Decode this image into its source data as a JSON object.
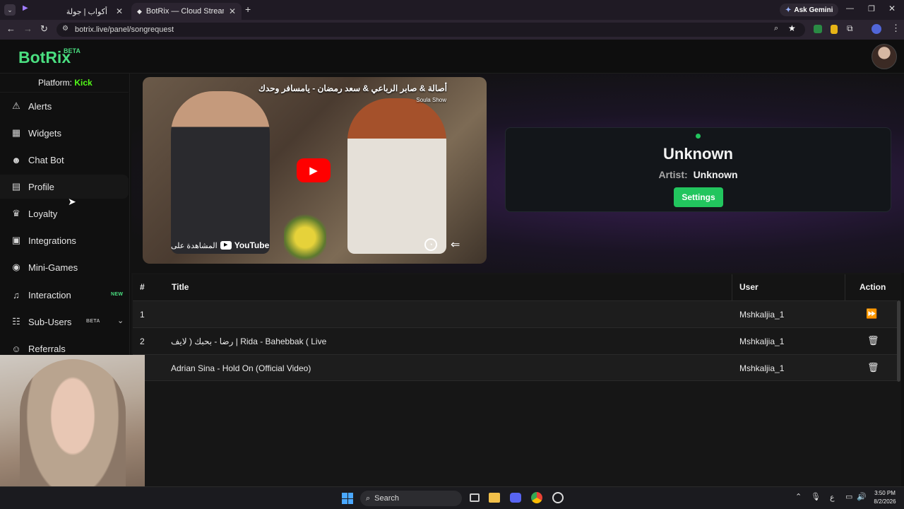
{
  "browser": {
    "tabs": [
      {
        "title": "أكواب | جولة",
        "active": false
      },
      {
        "title": "BotRix — Cloud Streaming Bot",
        "active": true
      }
    ],
    "ask_gemini": "Ask Gemini",
    "url": "botrix.live/panel/songrequest"
  },
  "app": {
    "logo": "BotRix",
    "logo_badge": "BETA",
    "platform_label": "Platform:",
    "platform_value": "Kick",
    "sidebar": [
      {
        "label": "Alerts",
        "icon": "warning-icon",
        "badge": ""
      },
      {
        "label": "Widgets",
        "icon": "grid-icon",
        "badge": ""
      },
      {
        "label": "Chat Bot",
        "icon": "robot-icon",
        "badge": ""
      },
      {
        "label": "Profile",
        "icon": "id-card-icon",
        "badge": ""
      },
      {
        "label": "Loyalty",
        "icon": "trophy-icon",
        "badge": ""
      },
      {
        "label": "Integrations",
        "icon": "plug-icon",
        "badge": ""
      },
      {
        "label": "Mini-Games",
        "icon": "gamepad-icon",
        "badge": ""
      },
      {
        "label": "Interaction",
        "icon": "music-note-icon",
        "badge": "NEW"
      },
      {
        "label": "Sub-Users",
        "icon": "users-icon",
        "badge": "BETA"
      },
      {
        "label": "Referrals",
        "icon": "user-plus-icon",
        "badge": ""
      }
    ],
    "video": {
      "title": "أصالة & صابر الرباعي & سعد رمضان - يامسافر وحدك",
      "channel": "Soula Show",
      "watch_on": "المشاهدة على",
      "youtube": "YouTube"
    },
    "now_playing": {
      "title": "Unknown",
      "artist_label": "Artist:",
      "artist_value": "Unknown",
      "settings_button": "Settings"
    },
    "queue": {
      "headers": {
        "num": "#",
        "title": "Title",
        "user": "User",
        "action": "Action"
      },
      "rows": [
        {
          "num": "1",
          "title": "",
          "user": "Mshkaljia_1",
          "action": "skip"
        },
        {
          "num": "2",
          "title": "رضا - بحبك ( لايف | Rida - Bahebbak ( Live",
          "user": "Mshkaljia_1",
          "action": "delete"
        },
        {
          "num": "",
          "title": "Adrian Sina - Hold On (Official Video)",
          "user": "Mshkaljia_1",
          "action": "delete"
        }
      ]
    }
  },
  "taskbar": {
    "search": "Search",
    "time": "3:50 PM",
    "date": "8/2/2026",
    "lang": "ع"
  },
  "colors": {
    "brand_green": "#4ade80",
    "settings_green": "#22c55e",
    "kick_green": "#53fc18"
  }
}
